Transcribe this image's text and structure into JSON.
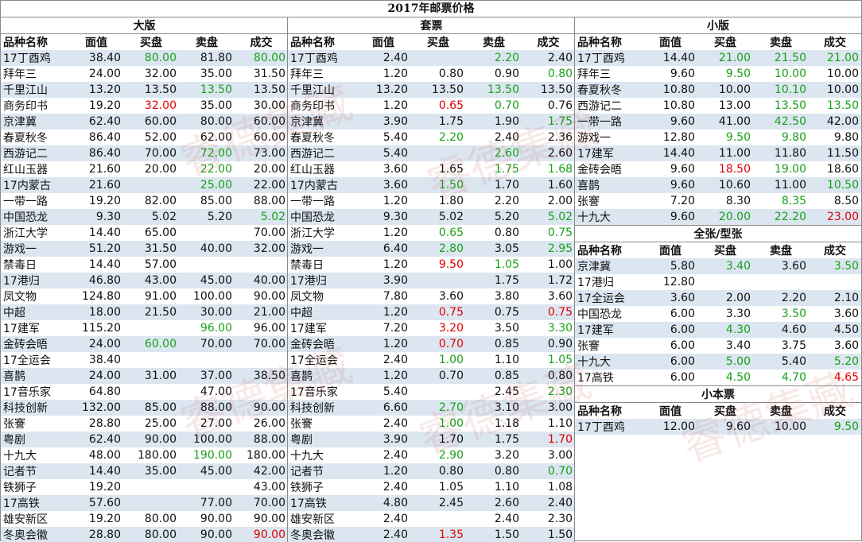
{
  "title": "2017年邮票价格",
  "columns": [
    "品种名称",
    "面值",
    "买盘",
    "卖盘",
    "成交"
  ],
  "sections": {
    "dab": {
      "title": "大版",
      "rows": [
        {
          "name": "17丁酉鸡",
          "face": "38.40",
          "buy": "80.00",
          "sell": "81.80",
          "deal": "80.00",
          "buy_color": "green",
          "deal_color": "green"
        },
        {
          "name": "拜年三",
          "face": "24.00",
          "buy": "32.00",
          "sell": "35.00",
          "deal": "31.50"
        },
        {
          "name": "千里江山",
          "face": "13.20",
          "buy": "13.50",
          "sell": "13.50",
          "deal": "13.50",
          "sell_color": "green"
        },
        {
          "name": "商务印书",
          "face": "19.20",
          "buy": "32.00",
          "sell": "35.00",
          "deal": "30.00",
          "buy_color": "red"
        },
        {
          "name": "京津冀",
          "face": "62.40",
          "buy": "60.00",
          "sell": "80.00",
          "deal": "60.00"
        },
        {
          "name": "春夏秋冬",
          "face": "86.40",
          "buy": "52.00",
          "sell": "62.00",
          "deal": "60.00"
        },
        {
          "name": "西游记二",
          "face": "86.40",
          "buy": "70.00",
          "sell": "72.00",
          "deal": "73.00",
          "sell_color": "green"
        },
        {
          "name": "红山玉器",
          "face": "21.60",
          "buy": "20.00",
          "sell": "22.00",
          "deal": "20.00",
          "sell_color": "green"
        },
        {
          "name": "17内蒙古",
          "face": "21.60",
          "buy": "",
          "sell": "25.00",
          "deal": "22.00",
          "sell_color": "green"
        },
        {
          "name": "一带一路",
          "face": "19.20",
          "buy": "82.00",
          "sell": "85.00",
          "deal": "88.00"
        },
        {
          "name": "中国恐龙",
          "face": "9.30",
          "buy": "5.02",
          "sell": "5.20",
          "deal": "5.02",
          "deal_color": "green"
        },
        {
          "name": "浙江大学",
          "face": "14.40",
          "buy": "65.00",
          "sell": "",
          "deal": "70.00"
        },
        {
          "name": "游戏一",
          "face": "51.20",
          "buy": "31.50",
          "sell": "40.00",
          "deal": "32.00"
        },
        {
          "name": "禁毒日",
          "face": "14.40",
          "buy": "57.00",
          "sell": "",
          "deal": ""
        },
        {
          "name": "17港归",
          "face": "46.80",
          "buy": "43.00",
          "sell": "45.00",
          "deal": "40.00"
        },
        {
          "name": "凤文物",
          "face": "124.80",
          "buy": "91.00",
          "sell": "100.00",
          "deal": "90.00"
        },
        {
          "name": "中超",
          "face": "18.00",
          "buy": "21.50",
          "sell": "30.00",
          "deal": "21.00"
        },
        {
          "name": "17建军",
          "face": "115.20",
          "buy": "",
          "sell": "96.00",
          "deal": "96.00",
          "sell_color": "green"
        },
        {
          "name": "金砖会晤",
          "face": "24.00",
          "buy": "60.00",
          "sell": "70.00",
          "deal": "70.00",
          "buy_color": "green"
        },
        {
          "name": "17全运会",
          "face": "38.40",
          "buy": "",
          "sell": "",
          "deal": ""
        },
        {
          "name": "喜鹊",
          "face": "24.00",
          "buy": "31.00",
          "sell": "37.00",
          "deal": "38.50"
        },
        {
          "name": "17音乐家",
          "face": "64.80",
          "buy": "",
          "sell": "47.00",
          "deal": ""
        },
        {
          "name": "科技创新",
          "face": "132.00",
          "buy": "85.00",
          "sell": "88.00",
          "deal": "90.00"
        },
        {
          "name": "张謇",
          "face": "28.80",
          "buy": "25.00",
          "sell": "27.00",
          "deal": "26.00"
        },
        {
          "name": "粤剧",
          "face": "62.40",
          "buy": "90.00",
          "sell": "100.00",
          "deal": "88.00"
        },
        {
          "name": "十九大",
          "face": "48.00",
          "buy": "180.00",
          "sell": "190.00",
          "deal": "180.00",
          "sell_color": "green"
        },
        {
          "name": "记者节",
          "face": "14.40",
          "buy": "35.00",
          "sell": "45.00",
          "deal": "42.00"
        },
        {
          "name": "铁狮子",
          "face": "19.20",
          "buy": "",
          "sell": "",
          "deal": "43.00"
        },
        {
          "name": "17高铁",
          "face": "57.60",
          "buy": "",
          "sell": "77.00",
          "deal": "70.00"
        },
        {
          "name": "雄安新区",
          "face": "19.20",
          "buy": "80.00",
          "sell": "90.00",
          "deal": "90.00"
        },
        {
          "name": "冬奥会徽",
          "face": "28.80",
          "buy": "80.00",
          "sell": "90.00",
          "deal": "90.00",
          "deal_color": "red"
        }
      ]
    },
    "taopiao": {
      "title": "套票",
      "rows": [
        {
          "name": "17丁酉鸡",
          "face": "2.40",
          "buy": "",
          "sell": "2.20",
          "deal": "2.40",
          "sell_color": "green"
        },
        {
          "name": "拜年三",
          "face": "1.20",
          "buy": "0.80",
          "sell": "0.90",
          "deal": "0.80",
          "deal_color": "green"
        },
        {
          "name": "千里江山",
          "face": "13.20",
          "buy": "13.50",
          "sell": "13.50",
          "deal": "13.50",
          "sell_color": "green"
        },
        {
          "name": "商务印书",
          "face": "1.20",
          "buy": "0.65",
          "sell": "0.70",
          "deal": "0.76",
          "buy_color": "red",
          "sell_color": "green"
        },
        {
          "name": "京津冀",
          "face": "3.90",
          "buy": "1.75",
          "sell": "1.90",
          "deal": "1.75",
          "deal_color": "green"
        },
        {
          "name": "春夏秋冬",
          "face": "5.40",
          "buy": "2.20",
          "sell": "2.40",
          "deal": "2.36",
          "buy_color": "green"
        },
        {
          "name": "西游记二",
          "face": "5.40",
          "buy": "",
          "sell": "2.60",
          "deal": "2.60",
          "sell_color": "green"
        },
        {
          "name": "红山玉器",
          "face": "3.60",
          "buy": "1.65",
          "sell": "1.75",
          "deal": "1.68",
          "sell_color": "green",
          "deal_color": "green"
        },
        {
          "name": "17内蒙古",
          "face": "3.60",
          "buy": "1.50",
          "sell": "1.70",
          "deal": "1.60",
          "buy_color": "green"
        },
        {
          "name": "一带一路",
          "face": "1.20",
          "buy": "1.80",
          "sell": "2.20",
          "deal": "2.00"
        },
        {
          "name": "中国恐龙",
          "face": "9.30",
          "buy": "5.02",
          "sell": "5.20",
          "deal": "5.02",
          "deal_color": "green"
        },
        {
          "name": "浙江大学",
          "face": "1.20",
          "buy": "0.65",
          "sell": "0.80",
          "deal": "0.75",
          "buy_color": "green",
          "deal_color": "green"
        },
        {
          "name": "游戏一",
          "face": "6.40",
          "buy": "2.80",
          "sell": "3.05",
          "deal": "2.95",
          "buy_color": "green",
          "deal_color": "green"
        },
        {
          "name": "禁毒日",
          "face": "1.20",
          "buy": "9.50",
          "sell": "1.05",
          "deal": "1.00",
          "buy_color": "red",
          "sell_color": "green"
        },
        {
          "name": "17港归",
          "face": "3.90",
          "buy": "",
          "sell": "1.75",
          "deal": "1.72"
        },
        {
          "name": "凤文物",
          "face": "7.80",
          "buy": "3.60",
          "sell": "3.80",
          "deal": "3.60"
        },
        {
          "name": "中超",
          "face": "1.20",
          "buy": "0.75",
          "sell": "0.75",
          "deal": "0.75",
          "buy_color": "red",
          "deal_color": "red"
        },
        {
          "name": "17建军",
          "face": "7.20",
          "buy": "3.20",
          "sell": "3.50",
          "deal": "3.30",
          "buy_color": "red",
          "deal_color": "green"
        },
        {
          "name": "金砖会晤",
          "face": "1.20",
          "buy": "0.70",
          "sell": "0.85",
          "deal": "0.90",
          "buy_color": "red"
        },
        {
          "name": "17全运会",
          "face": "2.40",
          "buy": "1.00",
          "sell": "1.10",
          "deal": "1.05",
          "buy_color": "green",
          "deal_color": "green"
        },
        {
          "name": "喜鹊",
          "face": "1.20",
          "buy": "0.70",
          "sell": "0.85",
          "deal": "0.80"
        },
        {
          "name": "17音乐家",
          "face": "5.40",
          "buy": "",
          "sell": "2.45",
          "deal": "2.30",
          "deal_color": "green"
        },
        {
          "name": "科技创新",
          "face": "6.60",
          "buy": "2.70",
          "sell": "3.10",
          "deal": "3.00",
          "buy_color": "green"
        },
        {
          "name": "张謇",
          "face": "2.40",
          "buy": "1.00",
          "sell": "1.18",
          "deal": "1.10",
          "buy_color": "green"
        },
        {
          "name": "粤剧",
          "face": "3.90",
          "buy": "1.70",
          "sell": "1.75",
          "deal": "1.70",
          "deal_color": "red"
        },
        {
          "name": "十九大",
          "face": "2.40",
          "buy": "2.90",
          "sell": "3.20",
          "deal": "3.00",
          "buy_color": "green"
        },
        {
          "name": "记者节",
          "face": "1.20",
          "buy": "0.80",
          "sell": "0.80",
          "deal": "0.70",
          "deal_color": "green"
        },
        {
          "name": "铁狮子",
          "face": "2.40",
          "buy": "1.05",
          "sell": "1.10",
          "deal": "1.08"
        },
        {
          "name": "17高铁",
          "face": "4.80",
          "buy": "2.45",
          "sell": "2.60",
          "deal": "2.40"
        },
        {
          "name": "雄安新区",
          "face": "2.40",
          "buy": "",
          "sell": "2.40",
          "deal": "2.30"
        },
        {
          "name": "冬奥会徽",
          "face": "2.40",
          "buy": "1.35",
          "sell": "1.50",
          "deal": "1.50",
          "buy_color": "red"
        }
      ]
    },
    "xiaoban": {
      "title": "小版",
      "rows": [
        {
          "name": "17丁酉鸡",
          "face": "14.40",
          "buy": "21.00",
          "sell": "21.50",
          "deal": "21.00",
          "buy_color": "green",
          "sell_color": "green",
          "deal_color": "green"
        },
        {
          "name": "拜年三",
          "face": "9.60",
          "buy": "9.50",
          "sell": "10.00",
          "deal": "10.00",
          "buy_color": "green",
          "sell_color": "green"
        },
        {
          "name": "春夏秋冬",
          "face": "10.80",
          "buy": "10.00",
          "sell": "10.10",
          "deal": "10.00",
          "sell_color": "green"
        },
        {
          "name": "西游记二",
          "face": "10.80",
          "buy": "13.00",
          "sell": "13.50",
          "deal": "13.50",
          "sell_color": "green",
          "deal_color": "green"
        },
        {
          "name": "一带一路",
          "face": "9.60",
          "buy": "41.00",
          "sell": "42.50",
          "deal": "42.00",
          "sell_color": "green"
        },
        {
          "name": "游戏一",
          "face": "12.80",
          "buy": "9.50",
          "sell": "9.80",
          "deal": "9.80",
          "buy_color": "green",
          "sell_color": "green"
        },
        {
          "name": "17建军",
          "face": "14.40",
          "buy": "11.00",
          "sell": "11.80",
          "deal": "11.50"
        },
        {
          "name": "金砖会晤",
          "face": "9.60",
          "buy": "18.50",
          "sell": "19.00",
          "deal": "18.60",
          "buy_color": "red",
          "sell_color": "green"
        },
        {
          "name": "喜鹊",
          "face": "9.60",
          "buy": "10.60",
          "sell": "11.00",
          "deal": "10.50",
          "deal_color": "green"
        },
        {
          "name": "张謇",
          "face": "7.20",
          "buy": "8.30",
          "sell": "8.35",
          "deal": "8.50",
          "sell_color": "green"
        },
        {
          "name": "十九大",
          "face": "9.60",
          "buy": "20.00",
          "sell": "22.20",
          "deal": "23.00",
          "buy_color": "green",
          "sell_color": "green",
          "deal_color": "red"
        }
      ]
    },
    "quanzhang": {
      "title": "全张/型张",
      "rows": [
        {
          "name": "京津冀",
          "face": "5.80",
          "buy": "3.40",
          "sell": "3.60",
          "deal": "3.50",
          "buy_color": "green",
          "deal_color": "green"
        },
        {
          "name": "17港归",
          "face": "12.80",
          "buy": "",
          "sell": "",
          "deal": ""
        },
        {
          "name": "17全运会",
          "face": "3.60",
          "buy": "2.00",
          "sell": "2.20",
          "deal": "2.10"
        },
        {
          "name": "中国恐龙",
          "face": "6.00",
          "buy": "3.30",
          "sell": "3.50",
          "deal": "3.60",
          "sell_color": "green"
        },
        {
          "name": "17建军",
          "face": "6.00",
          "buy": "4.30",
          "sell": "4.60",
          "deal": "4.50",
          "buy_color": "green"
        },
        {
          "name": "张謇",
          "face": "6.00",
          "buy": "3.40",
          "sell": "3.75",
          "deal": "3.60"
        },
        {
          "name": "十九大",
          "face": "6.00",
          "buy": "5.00",
          "sell": "5.40",
          "deal": "5.20",
          "buy_color": "green",
          "deal_color": "green"
        },
        {
          "name": "17高铁",
          "face": "6.00",
          "buy": "4.50",
          "sell": "4.70",
          "deal": "4.65",
          "buy_color": "green",
          "sell_color": "green",
          "deal_color": "red"
        }
      ]
    },
    "xiaobenpiao": {
      "title": "小本票",
      "rows": [
        {
          "name": "17丁酉鸡",
          "face": "12.00",
          "buy": "9.60",
          "sell": "10.00",
          "deal": "9.50",
          "deal_color": "green"
        }
      ]
    }
  },
  "watermark": "睿德集藏"
}
